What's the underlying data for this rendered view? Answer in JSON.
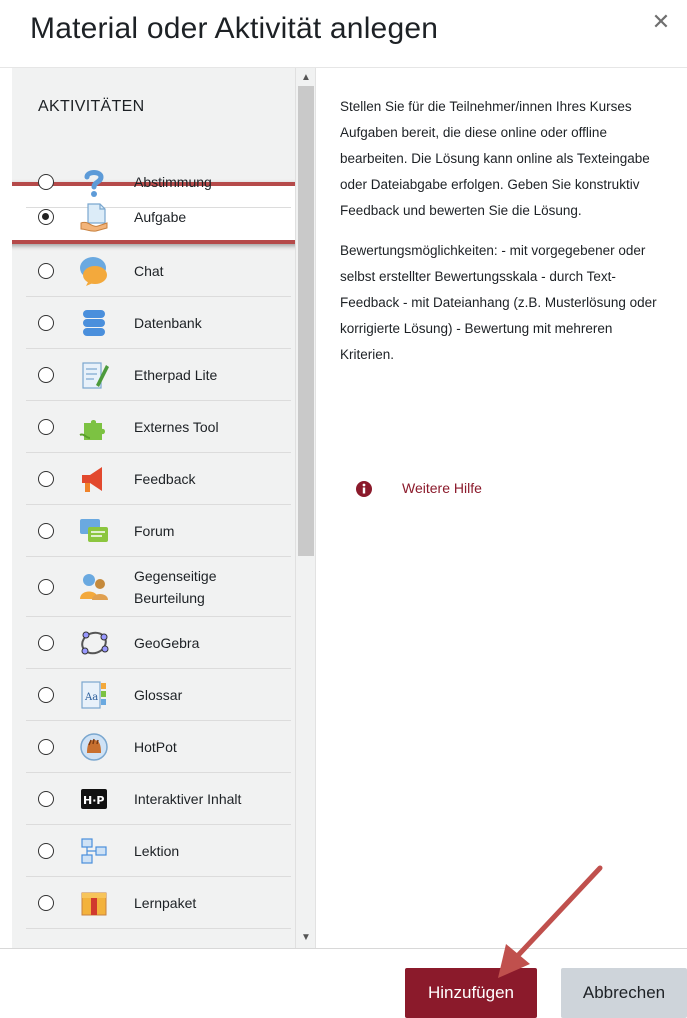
{
  "modal": {
    "title": "Material oder Aktivität anlegen",
    "close_icon": "close-icon"
  },
  "options": {
    "section_label": "AKTIVITÄTEN",
    "selected_index": 1,
    "items": [
      {
        "label": "Abstimmung",
        "icon": "question-icon"
      },
      {
        "label": "Aufgabe",
        "icon": "assignment-icon"
      },
      {
        "label": "Chat",
        "icon": "chat-icon"
      },
      {
        "label": "Datenbank",
        "icon": "database-icon"
      },
      {
        "label": "Etherpad Lite",
        "icon": "etherpad-icon"
      },
      {
        "label": "Externes Tool",
        "icon": "puzzle-icon"
      },
      {
        "label": "Feedback",
        "icon": "megaphone-icon"
      },
      {
        "label": "Forum",
        "icon": "forum-icon"
      },
      {
        "label": "Gegenseitige Beurteilung",
        "icon": "peer-review-icon"
      },
      {
        "label": "GeoGebra",
        "icon": "geogebra-icon"
      },
      {
        "label": "Glossar",
        "icon": "glossary-icon"
      },
      {
        "label": "HotPot",
        "icon": "hotpot-icon"
      },
      {
        "label": "Interaktiver Inhalt",
        "icon": "h5p-icon"
      },
      {
        "label": "Lektion",
        "icon": "lesson-icon"
      },
      {
        "label": "Lernpaket",
        "icon": "package-icon"
      }
    ]
  },
  "help": {
    "paragraph1": "Stellen Sie für die Teilnehmer/innen Ihres Kurses Aufgaben bereit, die diese online oder offline bearbeiten. Die Lösung kann online als Texteingabe oder Dateiabgabe erfolgen. Geben Sie konstruktiv Feedback und bewerten Sie die Lösung.",
    "paragraph2": "Bewertungsmöglichkeiten: - mit vorgegebener oder selbst erstellter Bewertungsskala - durch Text-Feedback - mit Dateianhang (z.B. Musterlösung oder korrigierte Lösung) - Bewertung mit mehreren Kriterien.",
    "more_help": "Weitere Hilfe"
  },
  "footer": {
    "add_label": "Hinzufügen",
    "cancel_label": "Abbrechen"
  },
  "colors": {
    "accent": "#8b1a2b",
    "highlight_frame": "#b54a4a",
    "pane_bg": "#f1f2f2",
    "cancel_bg": "#ced4da"
  }
}
